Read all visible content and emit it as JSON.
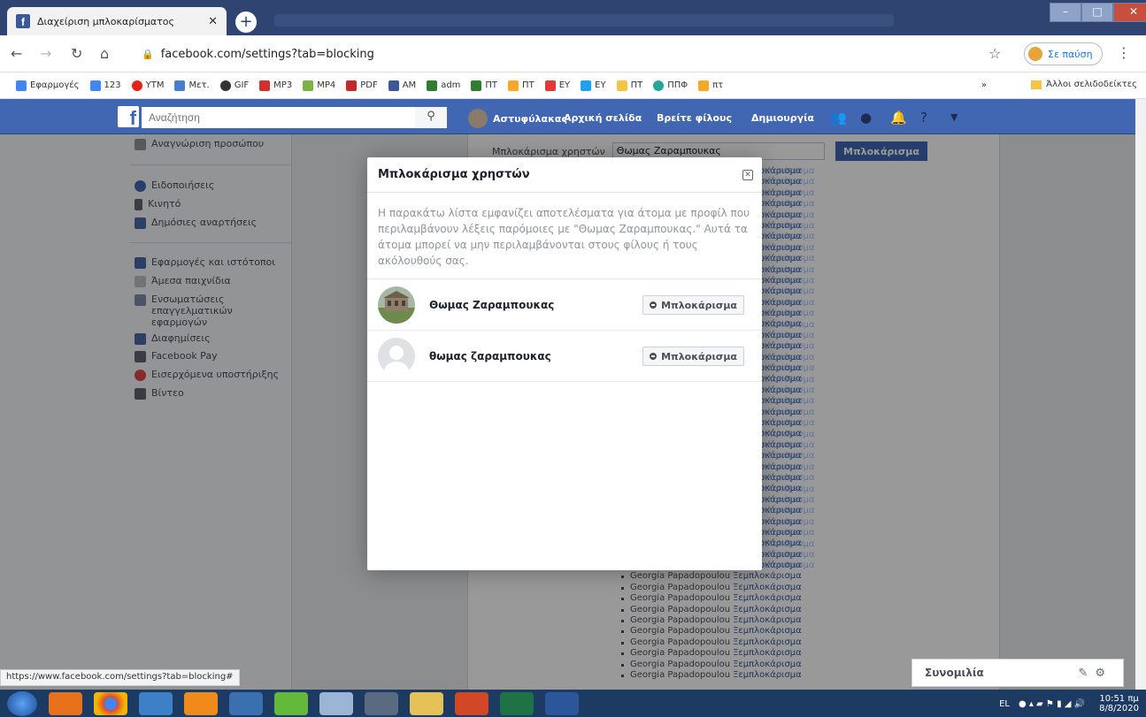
{
  "browser": {
    "tab_title": "Διαχείριση μπλοκαρίσματος",
    "url": "facebook.com/settings?tab=blocking",
    "profile_label": "Σε παύση",
    "bookmarks": [
      "Εφαρμογές",
      "123",
      "YTM",
      "Μετ.",
      "GIF",
      "MP3",
      "MP4",
      "PDF",
      "AM",
      "adm",
      "ΠΤ",
      "ΠΤ",
      "EY",
      "EY",
      "ΠΤ",
      "ΠΠΦ",
      "πτ"
    ],
    "bookmark_more": "»",
    "other_bookmarks": "Άλλοι σελιδοδείκτες",
    "status_url": "https://www.facebook.com/settings?tab=blocking#"
  },
  "facebook": {
    "search_placeholder": "Αναζήτηση",
    "user_name": "Αστυφύλακας",
    "nav": [
      "Αρχική σελίδα",
      "Βρείτε φίλους",
      "Δημιουργία"
    ]
  },
  "sidebar": {
    "items": [
      "Αναγνώριση προσώπου",
      "Ειδοποιήσεις",
      "Κινητό",
      "Δημόσιες αναρτήσεις",
      "Εφαρμογές και ιστότοποι",
      "Άμεσα παιχνίδια",
      "Ενσωματώσεις επαγγελματικών εφαρμογών",
      "Διαφημίσεις",
      "Facebook Pay",
      "Εισερχόμενα υποστήριξης",
      "Βίντεο"
    ]
  },
  "blocking": {
    "label": "Μπλοκάρισμα χρηστών",
    "input_value": "Θωμας Ζαραμπουκας",
    "button": "Μπλοκάρισμα",
    "list_name": "Georgia Papadopoulou",
    "list_action": "Ξεμπλοκάρισμα",
    "list_action_partial": "πλοκάρισμα"
  },
  "dialog": {
    "title": "Μπλοκάρισμα χρηστών",
    "description": "Η παρακάτω λίστα εμφανίζει αποτελέσματα για άτομα με προφίλ που περιλαμβάνουν λέξεις παρόμοιες με \"Θωμας Ζαραμπουκας.\" Αυτά τα άτομα μπορεί να μην περιλαμβάνονται στους φίλους ή τους ακόλουθούς σας.",
    "results": [
      {
        "name": "Θωμας Ζαραμπουκας",
        "button": "Μπλοκάρισμα"
      },
      {
        "name": "θωμας ζαραμπουκας",
        "button": "Μπλοκάρισμα"
      }
    ]
  },
  "chat": {
    "label": "Συνομιλία"
  },
  "taskbar": {
    "lang": "EL",
    "time": "10:51 πμ",
    "date": "8/8/2020"
  }
}
